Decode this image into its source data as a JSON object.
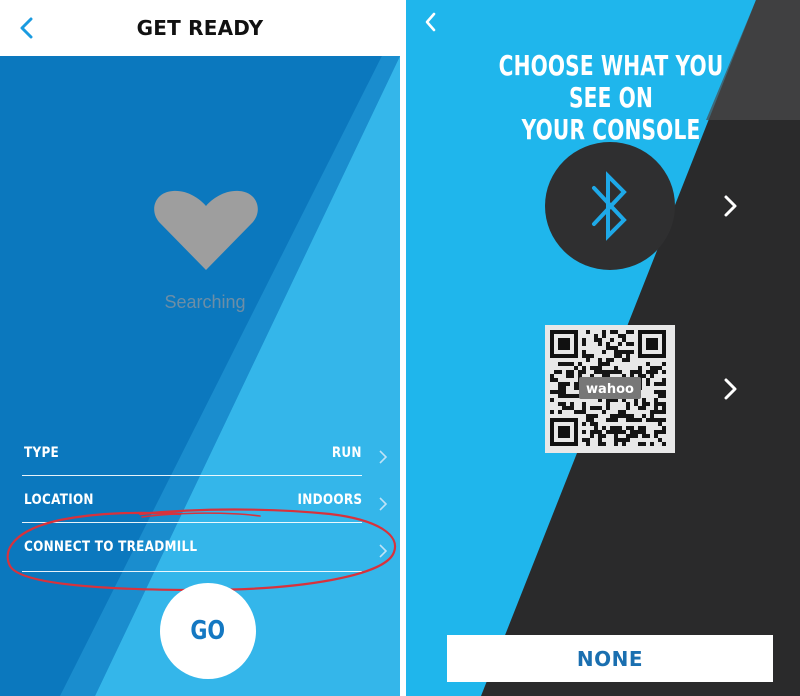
{
  "colors": {
    "left_dark_blue": "#0b78be",
    "left_light_blue": "#34b6ea",
    "right_cyan": "#1fb6ec",
    "right_dark": "#2f2f30",
    "heart_gray": "#9e9e9e",
    "annotation_red": "#d8323c",
    "go_text": "#1478c2",
    "none_text": "#1a6fb0"
  },
  "left_screen": {
    "header": {
      "title": "GET READY",
      "back_icon": "chevron-left-icon"
    },
    "status": {
      "icon": "heart-icon",
      "text": "Searching"
    },
    "settings": [
      {
        "label": "TYPE",
        "value": "RUN",
        "icon": "chevron-right-icon"
      },
      {
        "label": "LOCATION",
        "value": "INDOORS",
        "icon": "chevron-right-icon"
      },
      {
        "label": "CONNECT TO TREADMILL",
        "value": "",
        "icon": "chevron-right-icon"
      }
    ],
    "go_label": "GO"
  },
  "right_screen": {
    "back_icon": "chevron-left-icon",
    "heading_line1": "CHOOSE WHAT YOU SEE ON",
    "heading_line2": "YOUR CONSOLE",
    "options": [
      {
        "icon": "bluetooth-icon",
        "arrow_icon": "chevron-right-icon"
      },
      {
        "icon": "qr-code-icon",
        "qr_logo": "wahoo",
        "arrow_icon": "chevron-right-icon"
      }
    ],
    "none_label": "NONE"
  }
}
